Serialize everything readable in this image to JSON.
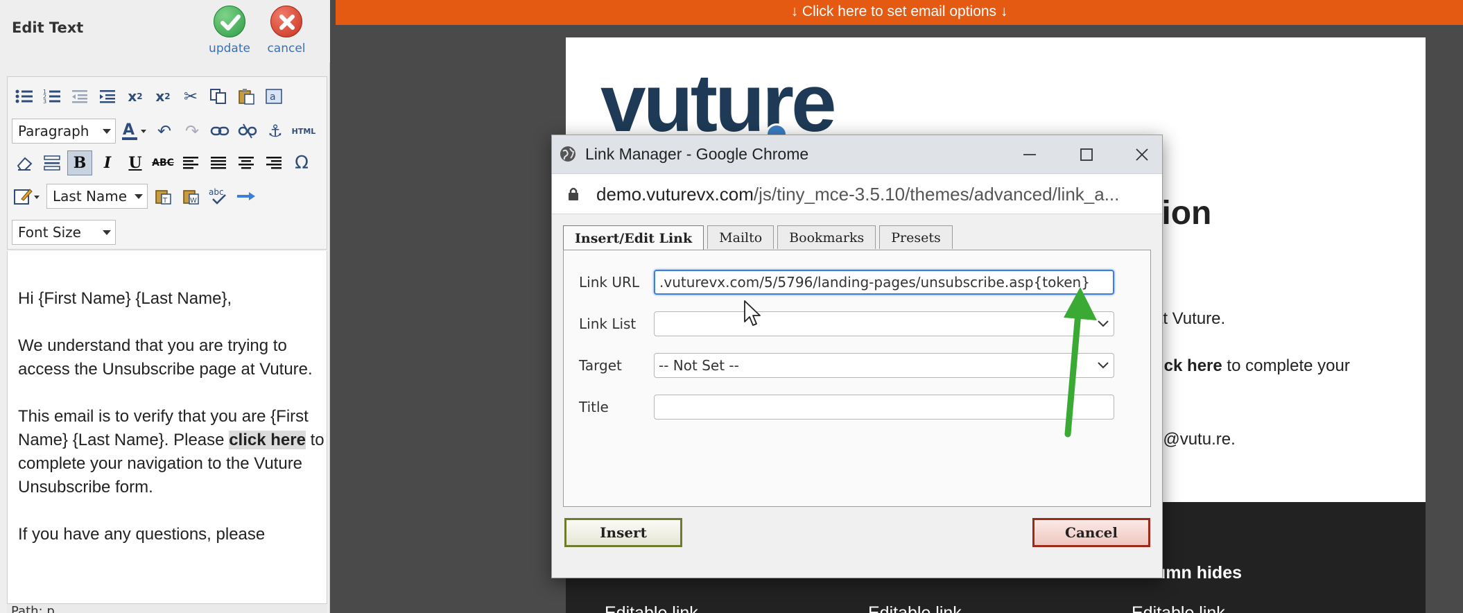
{
  "left_panel": {
    "title": "Edit Text",
    "update_label": "update",
    "cancel_label": "cancel",
    "toolbar": {
      "format_select": "Paragraph",
      "merge_field_select": "Last Name",
      "font_size_select": "Font Size",
      "html_label": "HTML",
      "bold_active": true
    },
    "content": {
      "greeting": "Hi {First Name} {Last Name},",
      "para1": "We understand that you are trying to access the Unsubscribe page at Vuture.",
      "para2_before": "This email is to verify that you are {First Name} {Last Name}. Please",
      "para2_link": "click here",
      "para2_after": "to complete your navigation to the Vuture Unsubscribe form.",
      "para3": "If you have any questions, please"
    },
    "status": "Path: p"
  },
  "email_preview": {
    "banner": "↓  Click here to set email options  ↓",
    "logo_text": "vuture",
    "headline_visible": "mation",
    "line1_visible": "at Vuture.",
    "line2_link": "click here",
    "line2_after": "to complete your",
    "line3_visible": "g@vutu.re.",
    "band_heading_visible": "umn hides",
    "band_links": [
      "Editable link",
      "Editable link",
      "Editable link"
    ]
  },
  "dialog": {
    "window_title": "Link Manager - Google Chrome",
    "url_domain": "demo.vuturevx.com",
    "url_path": "/js/tiny_mce-3.5.10/themes/advanced/link_a...",
    "tabs": [
      {
        "label": "Insert/Edit Link",
        "active": true
      },
      {
        "label": "Mailto",
        "active": false
      },
      {
        "label": "Bookmarks",
        "active": false
      },
      {
        "label": "Presets",
        "active": false
      }
    ],
    "fields": {
      "link_url_label": "Link URL",
      "link_url_value": ".vuturevx.com/5/5796/landing-pages/unsubscribe.asp{token}",
      "link_list_label": "Link List",
      "link_list_value": "",
      "target_label": "Target",
      "target_value": "-- Not Set --",
      "title_label": "Title",
      "title_value": ""
    },
    "insert_label": "Insert",
    "cancel_label": "Cancel"
  },
  "colors": {
    "banner": "#e55a12",
    "annotation_arrow": "#3aaa35",
    "focus_border": "#3d7ed8",
    "logo": "#1e3a56"
  }
}
